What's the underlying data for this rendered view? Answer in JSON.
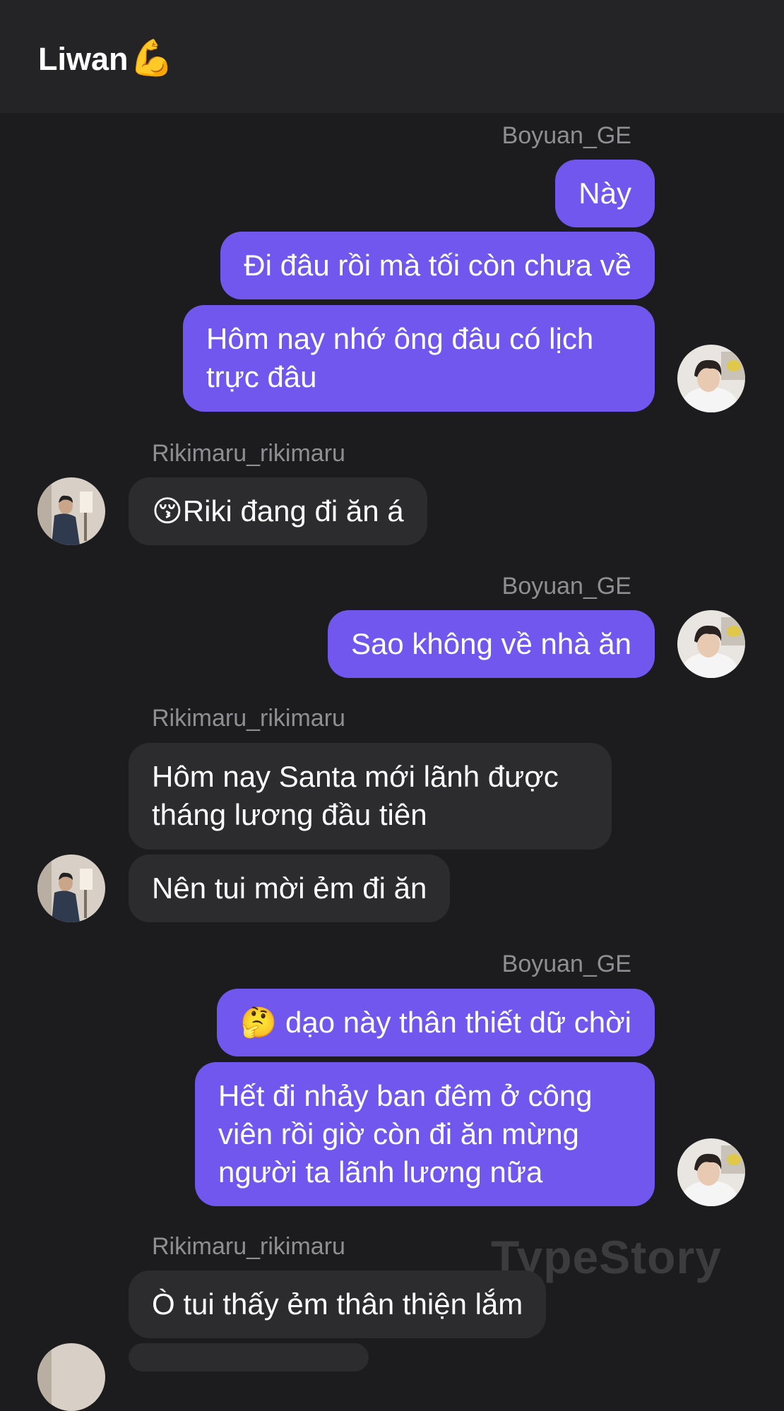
{
  "header": {
    "title": "Liwan",
    "title_emoji": "💪"
  },
  "watermark": "TypeStory",
  "colors": {
    "background": "#1c1c1e",
    "header": "#242426",
    "outgoing_bubble": "#7157ee",
    "incoming_bubble": "#2c2c2e",
    "sender_name": "#8e8e93"
  },
  "messages": [
    {
      "sender": "Boyuan_GE",
      "side": "right",
      "bubbles": [
        "Này",
        "Đi đâu rồi mà tối còn chưa về",
        "Hôm nay nhớ ông đâu có lịch trực đâu"
      ]
    },
    {
      "sender": "Rikimaru_rikimaru",
      "side": "left",
      "bubbles": [
        "😚Riki đang đi ăn á"
      ]
    },
    {
      "sender": "Boyuan_GE",
      "side": "right",
      "bubbles": [
        "Sao không về nhà ăn"
      ]
    },
    {
      "sender": "Rikimaru_rikimaru",
      "side": "left",
      "bubbles": [
        "Hôm nay Santa mới lãnh được tháng lương đầu tiên",
        "Nên tui mời ẻm đi ăn"
      ]
    },
    {
      "sender": "Boyuan_GE",
      "side": "right",
      "bubbles": [
        "🤔 dạo này thân thiết dữ chời",
        "Hết đi nhảy ban đêm ở công viên rồi giờ còn đi ăn mừng người ta lãnh lương nữa"
      ]
    },
    {
      "sender": "Rikimaru_rikimaru",
      "side": "left",
      "bubbles": [
        "Ò tui thấy ẻm thân thiện lắm"
      ]
    }
  ]
}
